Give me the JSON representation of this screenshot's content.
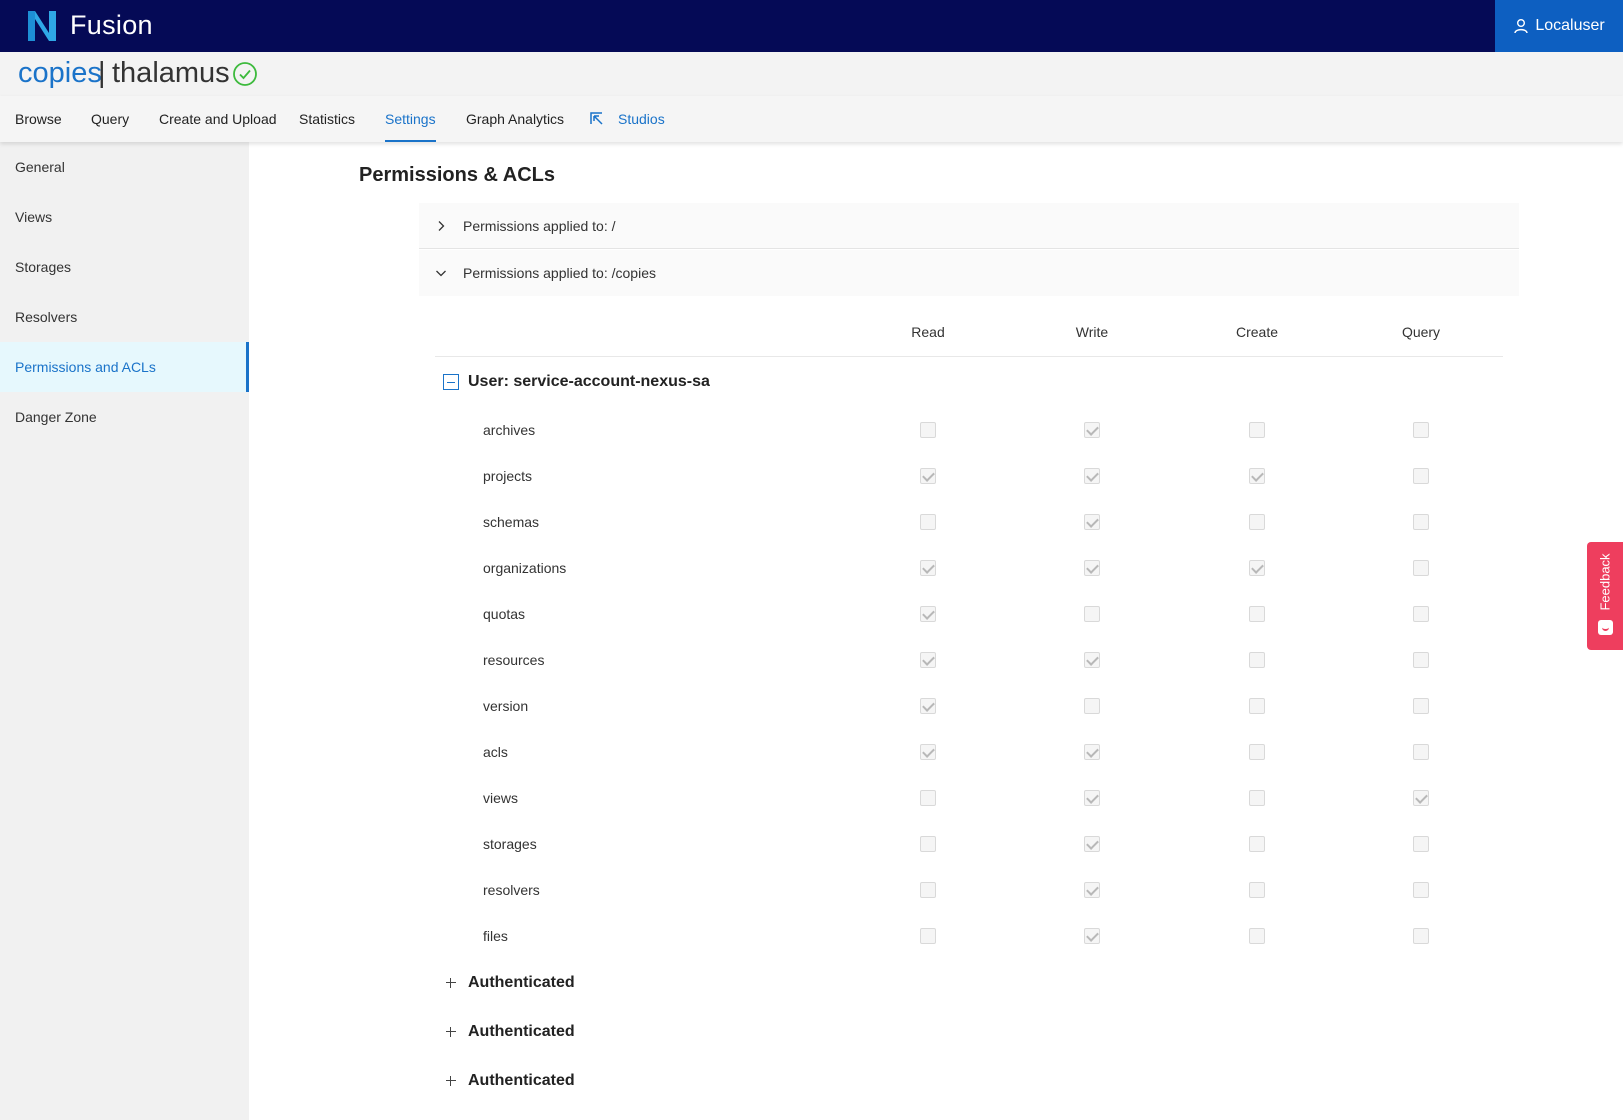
{
  "app": {
    "title": "Fusion",
    "user_label": "Localuser"
  },
  "project": {
    "org": "copies",
    "separator": "|",
    "name": "thalamus"
  },
  "tabs": [
    {
      "label": "Browse"
    },
    {
      "label": "Query"
    },
    {
      "label": "Create and Upload"
    },
    {
      "label": "Statistics"
    },
    {
      "label": "Settings"
    },
    {
      "label": "Graph Analytics"
    },
    {
      "label": "Studios"
    }
  ],
  "sidebar": {
    "items": [
      {
        "label": "General"
      },
      {
        "label": "Views"
      },
      {
        "label": "Storages"
      },
      {
        "label": "Resolvers"
      },
      {
        "label": "Permissions and ACLs"
      },
      {
        "label": "Danger Zone"
      }
    ]
  },
  "main": {
    "title": "Permissions & ACLs",
    "panels": [
      {
        "label": "Permissions applied to: /"
      },
      {
        "label": "Permissions applied to: /copies"
      }
    ],
    "columns": [
      "Read",
      "Write",
      "Create",
      "Query"
    ],
    "group": {
      "label": "User: service-account-nexus-sa",
      "rows": [
        {
          "name": "archives",
          "perms": [
            false,
            true,
            false,
            false
          ]
        },
        {
          "name": "projects",
          "perms": [
            true,
            true,
            true,
            false
          ]
        },
        {
          "name": "schemas",
          "perms": [
            false,
            true,
            false,
            false
          ]
        },
        {
          "name": "organizations",
          "perms": [
            true,
            true,
            true,
            false
          ]
        },
        {
          "name": "quotas",
          "perms": [
            true,
            false,
            false,
            false
          ]
        },
        {
          "name": "resources",
          "perms": [
            true,
            true,
            false,
            false
          ]
        },
        {
          "name": "version",
          "perms": [
            true,
            false,
            false,
            false
          ]
        },
        {
          "name": "acls",
          "perms": [
            true,
            true,
            false,
            false
          ]
        },
        {
          "name": "views",
          "perms": [
            false,
            true,
            false,
            true
          ]
        },
        {
          "name": "storages",
          "perms": [
            false,
            true,
            false,
            false
          ]
        },
        {
          "name": "resolvers",
          "perms": [
            false,
            true,
            false,
            false
          ]
        },
        {
          "name": "files",
          "perms": [
            false,
            true,
            false,
            false
          ]
        }
      ]
    },
    "collapsed_groups": [
      {
        "label": "Authenticated"
      },
      {
        "label": "Authenticated"
      },
      {
        "label": "Authenticated"
      }
    ]
  },
  "feedback": {
    "label": "Feedback"
  },
  "colors": {
    "topbar": "#050a56",
    "accent": "#1a73c9",
    "user_button": "#0d5fc1",
    "feedback": "#ee3e5e",
    "status_ok": "#3cba3c"
  }
}
